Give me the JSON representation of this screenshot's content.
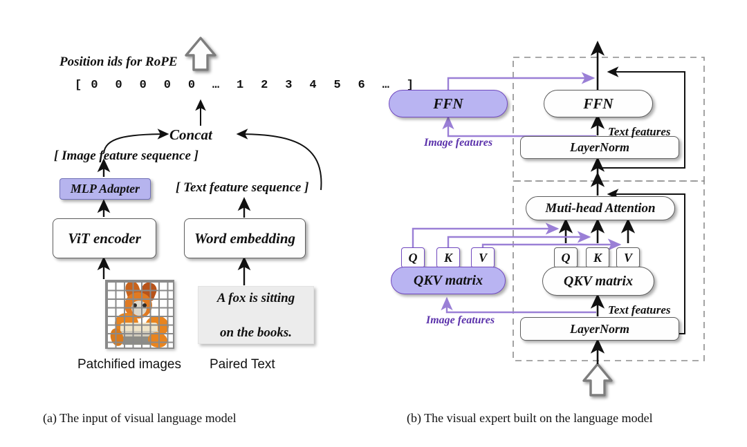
{
  "figure": {
    "panel_a": {
      "caption": "(a) The input of visual language model",
      "position_ids_label": "Position ids for RoPE",
      "position_ids_sequence": "[ 0  0  0  0  0  …  1  2  3  4  5  6  …  ]",
      "concat_label": "Concat",
      "image_feature_sequence": "[ Image feature sequence ]",
      "text_feature_sequence": "[ Text  feature sequence ]",
      "mlp_adapter": "MLP Adapter",
      "vit_encoder": "ViT encoder",
      "word_embedding": "Word embedding",
      "paired_text_line1": "A fox is sitting",
      "paired_text_line2": "on the books.",
      "patchified_images_caption": "Patchified images",
      "paired_text_caption": "Paired Text",
      "up_arrow_icon": "up-arrow-outline-icon"
    },
    "panel_b": {
      "caption": "(b) The visual expert built on the language model",
      "ffn_visual": "FFN",
      "ffn_text": "FFN",
      "layernorm_upper": "LayerNorm",
      "layernorm_lower": "LayerNorm",
      "attention": "Muti-head Attention",
      "qkv_visual": "QKV matrix",
      "qkv_text": "QKV matrix",
      "q_label": "Q",
      "k_label": "K",
      "v_label": "V",
      "image_features_upper": "Image features",
      "image_features_lower": "Image features",
      "text_features_upper": "Text features",
      "text_features_lower": "Text features",
      "input_arrow_icon": "up-arrow-outline-icon",
      "output_arrow_icon": "up-arrow-line-icon"
    }
  },
  "colors": {
    "visual_expert_fill": "#b9b4f2",
    "visual_expert_border": "#7149c0",
    "adapter_fill": "#b6b4ee",
    "adapter_border": "#6f6fb5",
    "image_feature_flow": "#9a7fd6",
    "image_features_text": "#5b32ab",
    "box_border": "#5d5d5d",
    "dashed_border": "#8c8c8c",
    "background": "#ffffff"
  }
}
